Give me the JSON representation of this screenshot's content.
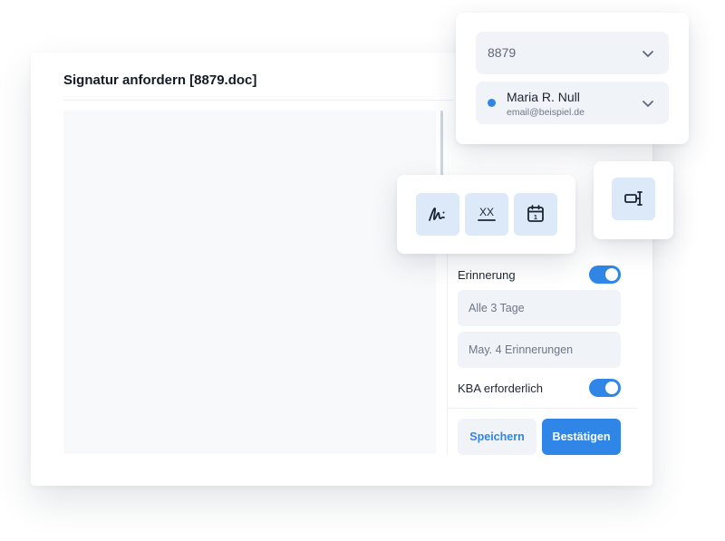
{
  "dialog": {
    "title": "Signatur anfordern [8879.doc]"
  },
  "recipient": {
    "document_value": "8879",
    "name": "Maria R. Null",
    "email": "email@beispiel.de",
    "status_color": "#2f86e6"
  },
  "tools": [
    {
      "icon": "signature-icon"
    },
    {
      "icon": "initials-icon",
      "label": "XX"
    },
    {
      "icon": "calendar-icon",
      "label": "1"
    }
  ],
  "extra_tool": {
    "icon": "stamp-icon"
  },
  "settings": {
    "reminder_label": "Erinnerung",
    "reminder_on": true,
    "interval_placeholder": "Alle 3 Tage",
    "max_placeholder": "May. 4 Erinnerungen",
    "kba_label": "KBA erforderlich",
    "kba_on": true
  },
  "actions": {
    "save_label": "Speichern",
    "confirm_label": "Bestätigen"
  },
  "colors": {
    "accent": "#2f86e6",
    "tool_bg": "#dce9f8",
    "field_bg": "#f0f3f8"
  }
}
